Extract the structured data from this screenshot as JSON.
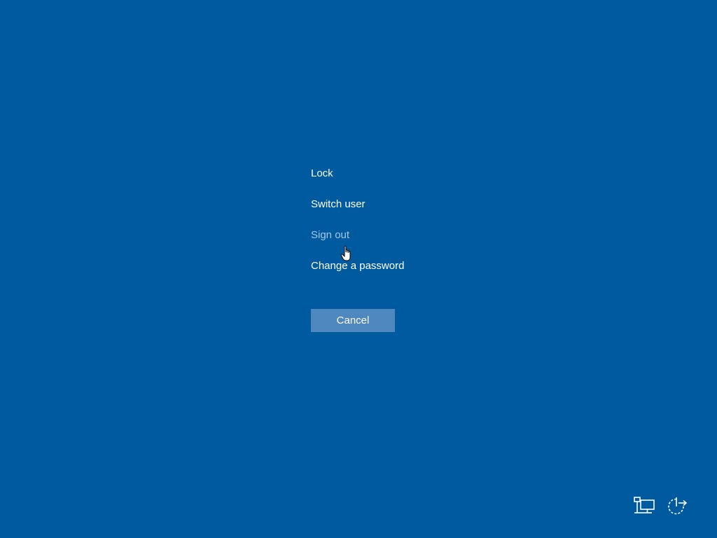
{
  "menu": {
    "items": [
      {
        "label": "Lock",
        "state": "normal"
      },
      {
        "label": "Switch user",
        "state": "normal"
      },
      {
        "label": "Sign out",
        "state": "hover"
      },
      {
        "label": "Change a password",
        "state": "normal"
      }
    ]
  },
  "cancel_button": {
    "label": "Cancel"
  },
  "tray": {
    "icons": [
      "network-icon",
      "power-icon"
    ]
  },
  "colors": {
    "background": "#005aa0",
    "button": "#4f87bf",
    "hover_text": "#a9c8e8",
    "text": "#ffffff"
  }
}
